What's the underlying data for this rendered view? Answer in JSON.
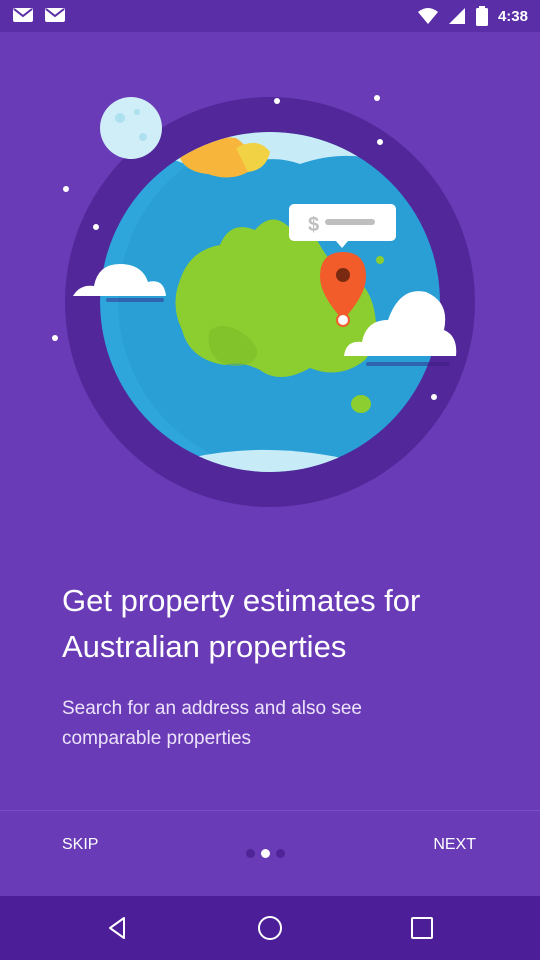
{
  "status_bar": {
    "time": "4:38",
    "left_icons": [
      "mail-icon",
      "mail-icon"
    ],
    "right_icons": [
      "wifi-icon",
      "cell-signal-icon",
      "battery-icon"
    ]
  },
  "hero": {
    "illustration": "earth-with-australia-and-location-pin",
    "price_tag_symbol": "$"
  },
  "onboarding": {
    "title": "Get property estimates for Australian properties",
    "subtitle": "Search for an address and also see comparable properties"
  },
  "footer": {
    "skip_label": "SKIP",
    "next_label": "NEXT",
    "page_count": 3,
    "active_page": 2
  },
  "nav_bar": {
    "buttons": [
      "back-icon",
      "home-icon",
      "recents-icon"
    ]
  },
  "colors": {
    "background": "#6a3bb6",
    "status_bar": "#5a2ea6",
    "nav_bar": "#4c1e98",
    "ocean": "#2ea6dc",
    "land": "#8ccd2f",
    "pin": "#f25c2a"
  }
}
